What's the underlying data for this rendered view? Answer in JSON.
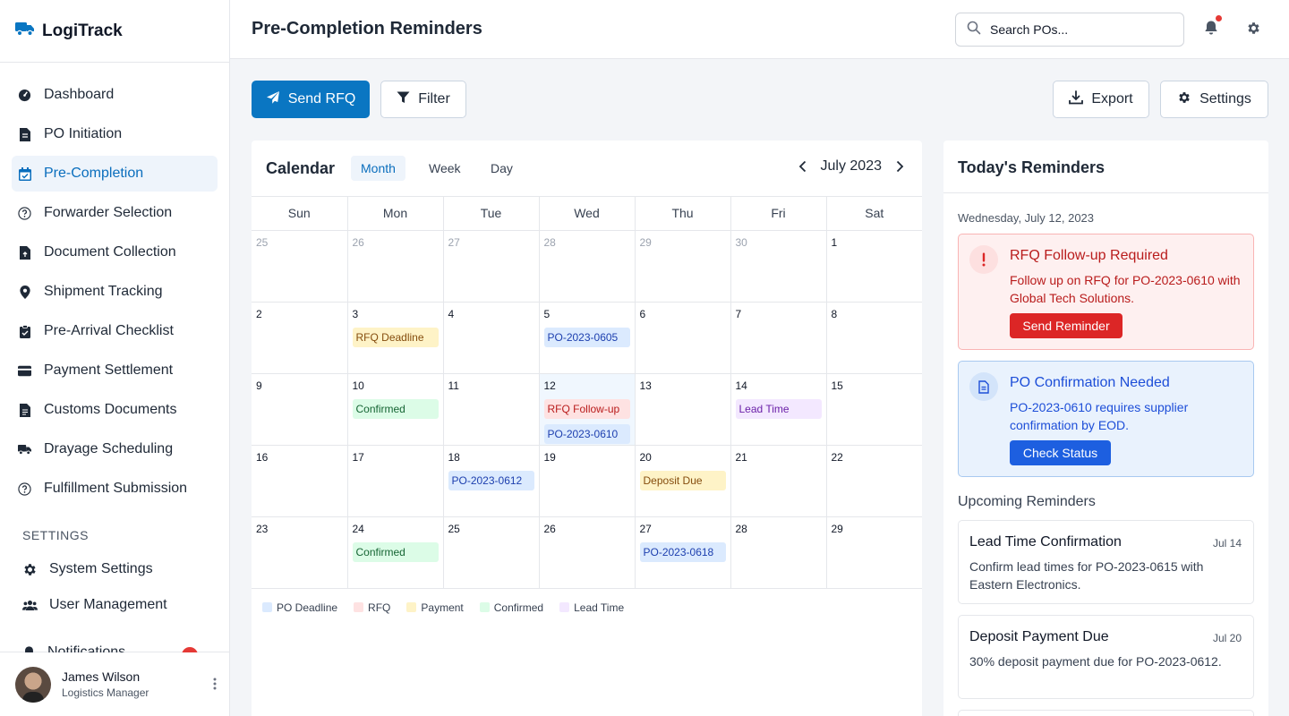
{
  "app": {
    "name": "LogiTrack",
    "brand_color": "#0a76c2"
  },
  "sidebar": {
    "items": [
      {
        "label": "Dashboard",
        "icon": "dashboard-icon",
        "active": false
      },
      {
        "label": "PO Initiation",
        "icon": "document-icon",
        "active": false
      },
      {
        "label": "Pre-Completion",
        "icon": "calendar-check-icon",
        "active": true
      },
      {
        "label": "Forwarder Selection",
        "icon": "question-circle-icon",
        "active": false
      },
      {
        "label": "Document Collection",
        "icon": "file-upload-icon",
        "active": false
      },
      {
        "label": "Shipment Tracking",
        "icon": "map-pin-icon",
        "active": false
      },
      {
        "label": "Pre-Arrival Checklist",
        "icon": "clipboard-check-icon",
        "active": false
      },
      {
        "label": "Payment Settlement",
        "icon": "credit-card-icon",
        "active": false
      },
      {
        "label": "Customs Documents",
        "icon": "file-text-icon",
        "active": false
      },
      {
        "label": "Drayage Scheduling",
        "icon": "truck-icon",
        "active": false
      },
      {
        "label": "Fulfillment Submission",
        "icon": "question-circle-icon",
        "active": false
      }
    ],
    "settings_heading": "SETTINGS",
    "settings_items": [
      {
        "label": "System Settings",
        "icon": "gear-icon"
      },
      {
        "label": "User Management",
        "icon": "users-icon"
      },
      {
        "label": "Notifications",
        "icon": "bell-icon"
      }
    ],
    "user": {
      "name": "James Wilson",
      "role": "Logistics Manager"
    }
  },
  "header": {
    "title": "Pre-Completion Reminders",
    "search_placeholder": "Search POs..."
  },
  "toolbar": {
    "send_rfq": "Send RFQ",
    "filter": "Filter",
    "export": "Export",
    "settings": "Settings"
  },
  "calendar": {
    "title": "Calendar",
    "views": [
      "Month",
      "Week",
      "Day"
    ],
    "active_view": "Month",
    "month_label": "July 2023",
    "weekdays": [
      "Sun",
      "Mon",
      "Tue",
      "Wed",
      "Thu",
      "Fri",
      "Sat"
    ],
    "weeks": [
      [
        {
          "day": "25",
          "muted": true,
          "events": []
        },
        {
          "day": "26",
          "muted": true,
          "events": []
        },
        {
          "day": "27",
          "muted": true,
          "events": []
        },
        {
          "day": "28",
          "muted": true,
          "events": []
        },
        {
          "day": "29",
          "muted": true,
          "events": []
        },
        {
          "day": "30",
          "muted": true,
          "events": []
        },
        {
          "day": "1",
          "events": []
        }
      ],
      [
        {
          "day": "2",
          "events": []
        },
        {
          "day": "3",
          "events": [
            {
              "label": "RFQ Deadline",
              "type": "payment"
            }
          ]
        },
        {
          "day": "4",
          "events": []
        },
        {
          "day": "5",
          "events": [
            {
              "label": "PO-2023-0605",
              "type": "po"
            }
          ]
        },
        {
          "day": "6",
          "events": []
        },
        {
          "day": "7",
          "events": []
        },
        {
          "day": "8",
          "events": []
        }
      ],
      [
        {
          "day": "9",
          "events": []
        },
        {
          "day": "10",
          "events": [
            {
              "label": "Confirmed",
              "type": "confirmed"
            }
          ]
        },
        {
          "day": "11",
          "events": []
        },
        {
          "day": "12",
          "today": true,
          "events": [
            {
              "label": "RFQ Follow-up",
              "type": "rfq"
            },
            {
              "label": "PO-2023-0610",
              "type": "po"
            }
          ]
        },
        {
          "day": "13",
          "events": []
        },
        {
          "day": "14",
          "events": [
            {
              "label": "Lead Time",
              "type": "lead"
            }
          ]
        },
        {
          "day": "15",
          "events": []
        }
      ],
      [
        {
          "day": "16",
          "events": []
        },
        {
          "day": "17",
          "events": []
        },
        {
          "day": "18",
          "events": [
            {
              "label": "PO-2023-0612",
              "type": "po"
            }
          ]
        },
        {
          "day": "19",
          "events": []
        },
        {
          "day": "20",
          "events": [
            {
              "label": "Deposit Due",
              "type": "payment"
            }
          ]
        },
        {
          "day": "21",
          "events": []
        },
        {
          "day": "22",
          "events": []
        }
      ],
      [
        {
          "day": "23",
          "events": []
        },
        {
          "day": "24",
          "events": [
            {
              "label": "Confirmed",
              "type": "confirmed"
            }
          ]
        },
        {
          "day": "25",
          "events": []
        },
        {
          "day": "26",
          "events": []
        },
        {
          "day": "27",
          "events": [
            {
              "label": "PO-2023-0618",
              "type": "po"
            }
          ]
        },
        {
          "day": "28",
          "events": []
        },
        {
          "day": "29",
          "events": []
        }
      ]
    ],
    "legend": [
      {
        "label": "PO Deadline",
        "color": "#dbeafe"
      },
      {
        "label": "RFQ",
        "color": "#fee2e2"
      },
      {
        "label": "Payment",
        "color": "#fef3c7"
      },
      {
        "label": "Confirmed",
        "color": "#dcfce7"
      },
      {
        "label": "Lead Time",
        "color": "#f3e8ff"
      }
    ]
  },
  "reminders": {
    "title": "Today's Reminders",
    "date": "Wednesday, July 12, 2023",
    "alerts": [
      {
        "title": "RFQ Follow-up Required",
        "body": "Follow up on RFQ for PO-2023-0610 with Global Tech Solutions.",
        "button": "Send Reminder",
        "icon": "exclamation-icon"
      },
      {
        "title": "PO Confirmation Needed",
        "body": "PO-2023-0610 requires supplier confirmation by EOD.",
        "button": "Check Status",
        "icon": "document-icon"
      }
    ],
    "upcoming_title": "Upcoming Reminders",
    "upcoming": [
      {
        "title": "Lead Time Confirmation",
        "date": "Jul 14",
        "body": "Confirm lead times for PO-2023-0615 with Eastern Electronics."
      },
      {
        "title": "Deposit Payment Due",
        "date": "Jul 20",
        "body": "30% deposit payment due for PO-2023-0612."
      }
    ]
  }
}
